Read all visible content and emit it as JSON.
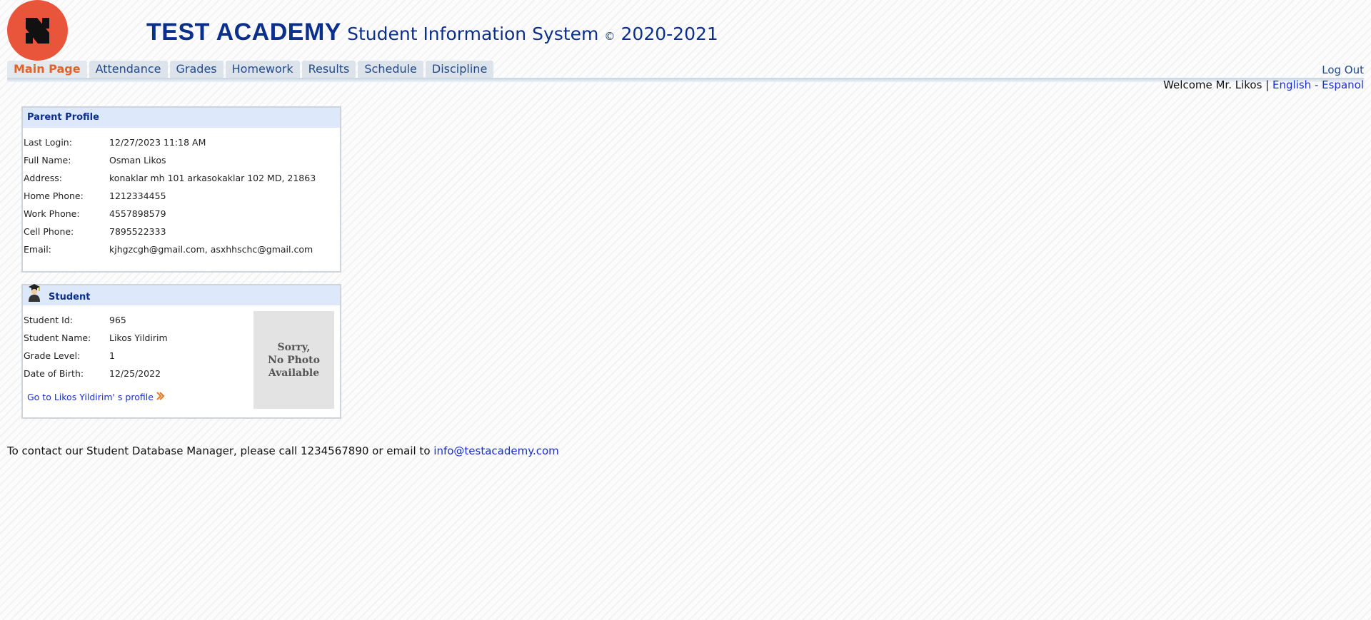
{
  "header": {
    "brand": "TEST ACADEMY",
    "system": "Student Information System",
    "copyright": "©",
    "years": "2020-2021",
    "logo_icon": "logo-icon",
    "accent": "#0b2f8c",
    "logo_color": "#e8553a"
  },
  "nav": {
    "tabs": [
      {
        "label": "Main Page",
        "active": true
      },
      {
        "label": "Attendance"
      },
      {
        "label": "Grades"
      },
      {
        "label": "Homework"
      },
      {
        "label": "Results"
      },
      {
        "label": "Schedule"
      },
      {
        "label": "Discipline"
      }
    ],
    "logout": "Log Out"
  },
  "welcome": {
    "text": "Welcome Mr. Likos |",
    "language": "English - Espanol"
  },
  "parent_profile": {
    "title": "Parent Profile",
    "rows": [
      {
        "label": "Last Login:",
        "value": "12/27/2023 11:18 AM"
      },
      {
        "label": "Full Name:",
        "value": "Osman Likos"
      },
      {
        "label": "Address:",
        "value": "konaklar mh 101 arkasokaklar 102 MD, 21863"
      },
      {
        "label": "Home Phone:",
        "value": "1212334455"
      },
      {
        "label": "Work Phone:",
        "value": "4557898579"
      },
      {
        "label": "Cell Phone:",
        "value": "7895522333"
      },
      {
        "label": "Email:",
        "value": "kjhgzcgh@gmail.com, asxhhschc@gmail.com"
      }
    ]
  },
  "student": {
    "title": "Student",
    "icon": "graduate-icon",
    "rows": [
      {
        "label": "Student Id:",
        "value": "965"
      },
      {
        "label": "Student Name:",
        "value": "Likos Yildirim"
      },
      {
        "label": "Grade Level:",
        "value": "1"
      },
      {
        "label": "Date of Birth:",
        "value": "12/25/2022"
      }
    ],
    "photo_placeholder": "Sorry,\nNo Photo\nAvailable",
    "profile_link": "Go to Likos Yildirim' s profile"
  },
  "footer": {
    "contact_text": "To contact our Student Database Manager, please call 1234567890 or email to",
    "email": "info@testacademy.com"
  }
}
